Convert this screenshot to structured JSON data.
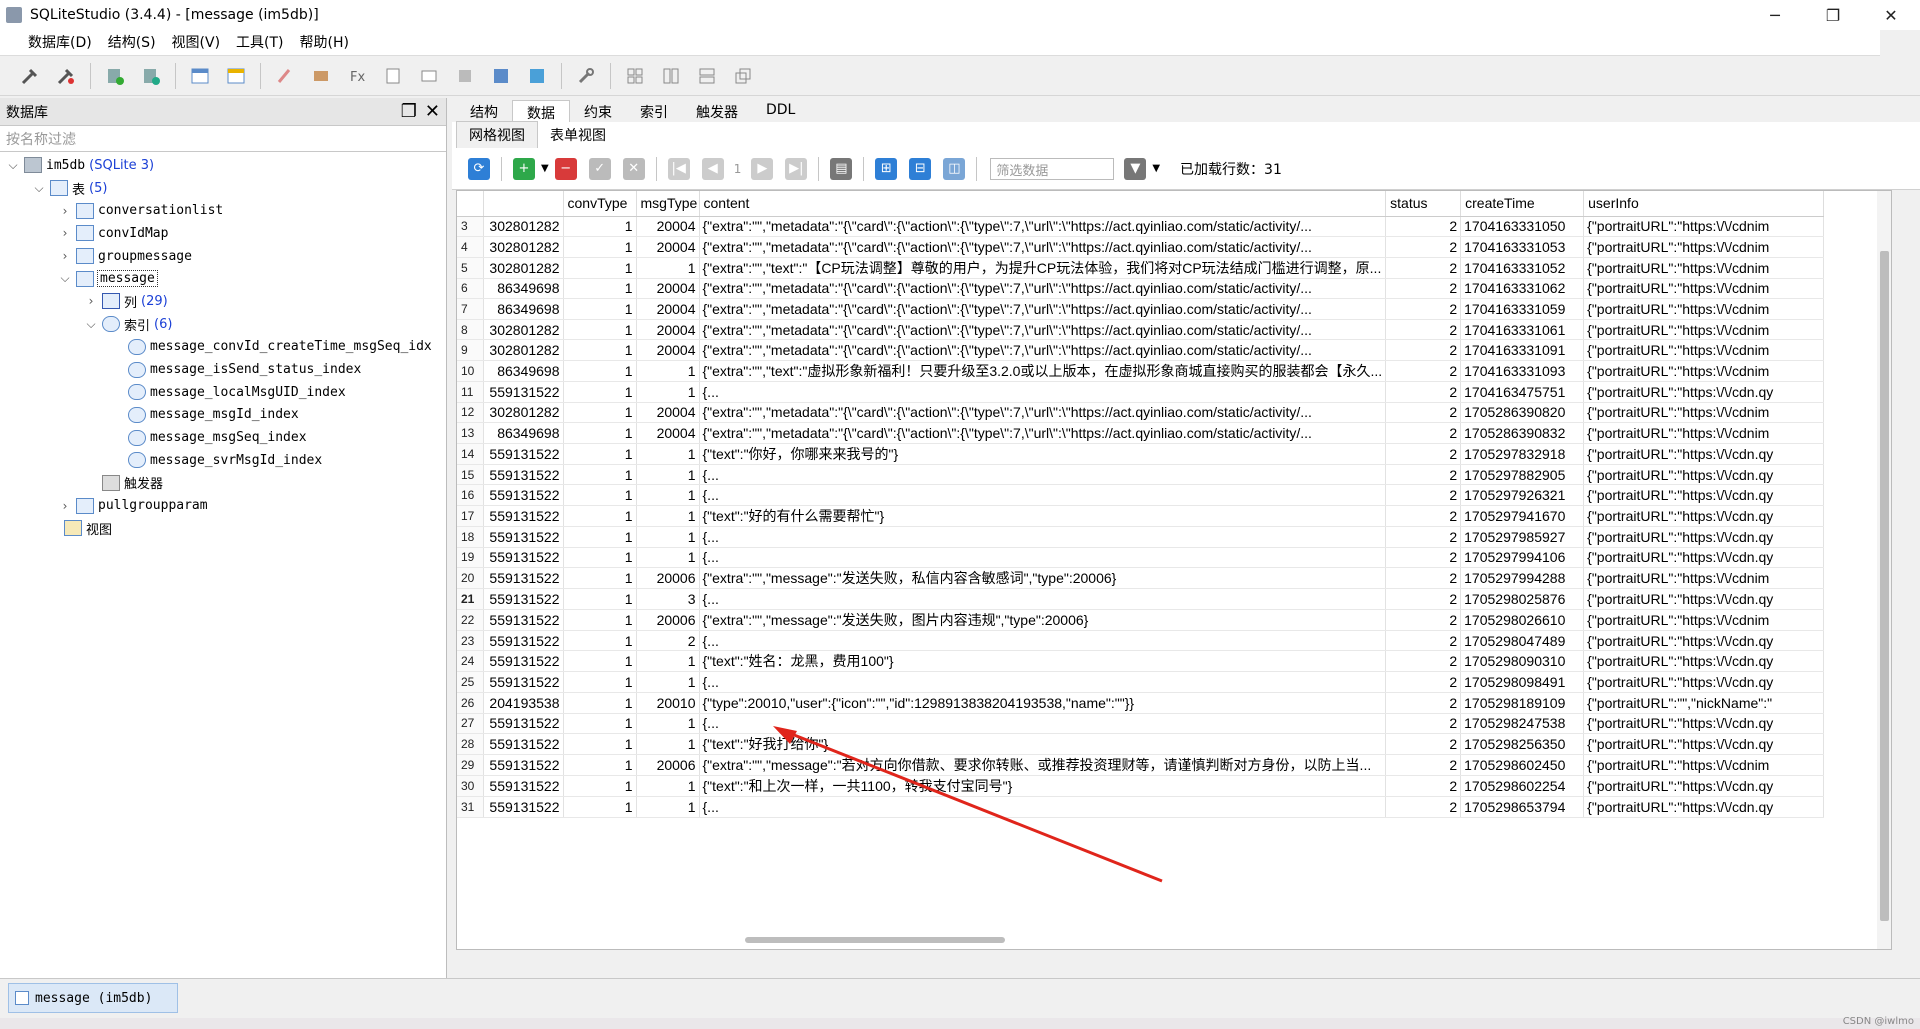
{
  "window": {
    "title": "SQLiteStudio (3.4.4) - [message (im5db)]",
    "min": "─",
    "max": "❐",
    "close": "✕"
  },
  "menu": [
    "数据库(D)",
    "结构(S)",
    "视图(V)",
    "工具(T)",
    "帮助(H)"
  ],
  "left_panel": {
    "title": "数据库",
    "filter_placeholder": "按名称过滤",
    "db": {
      "name": "im5db",
      "type": "(SQLite 3)"
    },
    "tables_label": "表",
    "tables_count": "(5)",
    "tables": [
      "conversationlist",
      "convIdMap",
      "groupmessage",
      "message",
      "pullgroupparam"
    ],
    "columns_label": "列",
    "columns_count": "(29)",
    "indexes_label": "索引",
    "indexes_count": "(6)",
    "indexes": [
      "message_convId_createTime_msgSeq_idx",
      "message_isSend_status_index",
      "message_localMsgUID_index",
      "message_msgId_index",
      "message_msgSeq_index",
      "message_svrMsgId_index"
    ],
    "triggers_label": "触发器",
    "views_label": "视图"
  },
  "tabs": [
    "结构",
    "数据",
    "约束",
    "索引",
    "触发器",
    "DDL"
  ],
  "subtabs": [
    "网格视图",
    "表单视图"
  ],
  "grid_toolbar": {
    "page": "1",
    "filter_placeholder": "筛选数据",
    "rows_loaded": "已加载行数：31"
  },
  "grid": {
    "columns": [
      "",
      "",
      "convType",
      "msgType",
      "content",
      "status",
      "createTime",
      "userInfo"
    ],
    "rows": [
      [
        "3",
        "302801282",
        "1",
        "20004",
        "{\"extra\":\"\",\"metadata\":\"{\\\"card\\\":{\\\"action\\\":{\\\"type\\\":7,\\\"url\\\":\\\"https://act.qyinliao.com/static/activity/...",
        "2",
        "1704163331050",
        "{\"portraitURL\":\"https:\\/\\/cdnim"
      ],
      [
        "4",
        "302801282",
        "1",
        "20004",
        "{\"extra\":\"\",\"metadata\":\"{\\\"card\\\":{\\\"action\\\":{\\\"type\\\":7,\\\"url\\\":\\\"https://act.qyinliao.com/static/activity/...",
        "2",
        "1704163331053",
        "{\"portraitURL\":\"https:\\/\\/cdnim"
      ],
      [
        "5",
        "302801282",
        "1",
        "1",
        "{\"extra\":\"\",\"text\":\"【CP玩法调整】尊敬的用户，为提升CP玩法体验，我们将对CP玩法结成门槛进行调整，原...",
        "2",
        "1704163331052",
        "{\"portraitURL\":\"https:\\/\\/cdnim"
      ],
      [
        "6",
        "86349698",
        "1",
        "20004",
        "{\"extra\":\"\",\"metadata\":\"{\\\"card\\\":{\\\"action\\\":{\\\"type\\\":7,\\\"url\\\":\\\"https://act.qyinliao.com/static/activity/...",
        "2",
        "1704163331062",
        "{\"portraitURL\":\"https:\\/\\/cdnim"
      ],
      [
        "7",
        "86349698",
        "1",
        "20004",
        "{\"extra\":\"\",\"metadata\":\"{\\\"card\\\":{\\\"action\\\":{\\\"type\\\":7,\\\"url\\\":\\\"https://act.qyinliao.com/static/activity/...",
        "2",
        "1704163331059",
        "{\"portraitURL\":\"https:\\/\\/cdnim"
      ],
      [
        "8",
        "302801282",
        "1",
        "20004",
        "{\"extra\":\"\",\"metadata\":\"{\\\"card\\\":{\\\"action\\\":{\\\"type\\\":7,\\\"url\\\":\\\"https://act.qyinliao.com/static/activity/...",
        "2",
        "1704163331061",
        "{\"portraitURL\":\"https:\\/\\/cdnim"
      ],
      [
        "9",
        "302801282",
        "1",
        "20004",
        "{\"extra\":\"\",\"metadata\":\"{\\\"card\\\":{\\\"action\\\":{\\\"type\\\":7,\\\"url\\\":\\\"https://act.qyinliao.com/static/activity/...",
        "2",
        "1704163331091",
        "{\"portraitURL\":\"https:\\/\\/cdnim"
      ],
      [
        "10",
        "86349698",
        "1",
        "1",
        "{\"extra\":\"\",\"text\":\"虚拟形象新福利！只要升级至3.2.0或以上版本，在虚拟形象商城直接购买的服装都会【永久...",
        "2",
        "1704163331093",
        "{\"portraitURL\":\"https:\\/\\/cdnim"
      ],
      [
        "11",
        "559131522",
        "1",
        "1",
        "{...",
        "2",
        "1704163475751",
        "{\"portraitURL\":\"https:\\/\\/cdn.qy"
      ],
      [
        "12",
        "302801282",
        "1",
        "20004",
        "{\"extra\":\"\",\"metadata\":\"{\\\"card\\\":{\\\"action\\\":{\\\"type\\\":7,\\\"url\\\":\\\"https://act.qyinliao.com/static/activity/...",
        "2",
        "1705286390820",
        "{\"portraitURL\":\"https:\\/\\/cdnim"
      ],
      [
        "13",
        "86349698",
        "1",
        "20004",
        "{\"extra\":\"\",\"metadata\":\"{\\\"card\\\":{\\\"action\\\":{\\\"type\\\":7,\\\"url\\\":\\\"https://act.qyinliao.com/static/activity/...",
        "2",
        "1705286390832",
        "{\"portraitURL\":\"https:\\/\\/cdnim"
      ],
      [
        "14",
        "559131522",
        "1",
        "1",
        "{\"text\":\"你好，你哪来来我号的\"}",
        "2",
        "1705297832918",
        "{\"portraitURL\":\"https:\\/\\/cdn.qy"
      ],
      [
        "15",
        "559131522",
        "1",
        "1",
        "{...",
        "2",
        "1705297882905",
        "{\"portraitURL\":\"https:\\/\\/cdn.qy"
      ],
      [
        "16",
        "559131522",
        "1",
        "1",
        "{...",
        "2",
        "1705297926321",
        "{\"portraitURL\":\"https:\\/\\/cdn.qy"
      ],
      [
        "17",
        "559131522",
        "1",
        "1",
        "{\"text\":\"好的有什么需要帮忙\"}",
        "2",
        "1705297941670",
        "{\"portraitURL\":\"https:\\/\\/cdn.qy"
      ],
      [
        "18",
        "559131522",
        "1",
        "1",
        "{...",
        "2",
        "1705297985927",
        "{\"portraitURL\":\"https:\\/\\/cdn.qy"
      ],
      [
        "19",
        "559131522",
        "1",
        "1",
        "{...",
        "2",
        "1705297994106",
        "{\"portraitURL\":\"https:\\/\\/cdn.qy"
      ],
      [
        "20",
        "559131522",
        "1",
        "20006",
        "{\"extra\":\"\",\"message\":\"发送失败，私信内容含敏感词\",\"type\":20006}",
        "2",
        "1705297994288",
        "{\"portraitURL\":\"https:\\/\\/cdnim"
      ],
      [
        "21",
        "559131522",
        "1",
        "3",
        "{...",
        "2",
        "1705298025876",
        "{\"portraitURL\":\"https:\\/\\/cdn.qy"
      ],
      [
        "22",
        "559131522",
        "1",
        "20006",
        "{\"extra\":\"\",\"message\":\"发送失败，图片内容违规\",\"type\":20006}",
        "2",
        "1705298026610",
        "{\"portraitURL\":\"https:\\/\\/cdnim"
      ],
      [
        "23",
        "559131522",
        "1",
        "2",
        "{...",
        "2",
        "1705298047489",
        "{\"portraitURL\":\"https:\\/\\/cdn.qy"
      ],
      [
        "24",
        "559131522",
        "1",
        "1",
        "{\"text\":\"姓名：龙黑，费用100\"}",
        "2",
        "1705298090310",
        "{\"portraitURL\":\"https:\\/\\/cdn.qy"
      ],
      [
        "25",
        "559131522",
        "1",
        "1",
        "{...",
        "2",
        "1705298098491",
        "{\"portraitURL\":\"https:\\/\\/cdn.qy"
      ],
      [
        "26",
        "204193538",
        "1",
        "20010",
        "{\"type\":20010,\"user\":{\"icon\":\"\",\"id\":1298913838204193538,\"name\":\"\"}}",
        "2",
        "1705298189109",
        "{\"portraitURL\":\"\",\"nickName\":\""
      ],
      [
        "27",
        "559131522",
        "1",
        "1",
        "{...",
        "2",
        "1705298247538",
        "{\"portraitURL\":\"https:\\/\\/cdn.qy"
      ],
      [
        "28",
        "559131522",
        "1",
        "1",
        "{\"text\":\"好我打给你\"}",
        "2",
        "1705298256350",
        "{\"portraitURL\":\"https:\\/\\/cdn.qy"
      ],
      [
        "29",
        "559131522",
        "1",
        "20006",
        "{\"extra\":\"\",\"message\":\"若对方向你借款、要求你转账、或推荐投资理财等，请谨慎判断对方身份，以防上当...",
        "2",
        "1705298602450",
        "{\"portraitURL\":\"https:\\/\\/cdnim"
      ],
      [
        "30",
        "559131522",
        "1",
        "1",
        "{\"text\":\"和上次一样，一共1100，转我支付宝同号\"}",
        "2",
        "1705298602254",
        "{\"portraitURL\":\"https:\\/\\/cdn.qy"
      ],
      [
        "31",
        "559131522",
        "1",
        "1",
        "{...",
        "2",
        "1705298653794",
        "{\"portraitURL\":\"https:\\/\\/cdn.qy"
      ]
    ]
  },
  "window_tab": "message (im5db)",
  "watermark": "CSDN @iwlmo"
}
